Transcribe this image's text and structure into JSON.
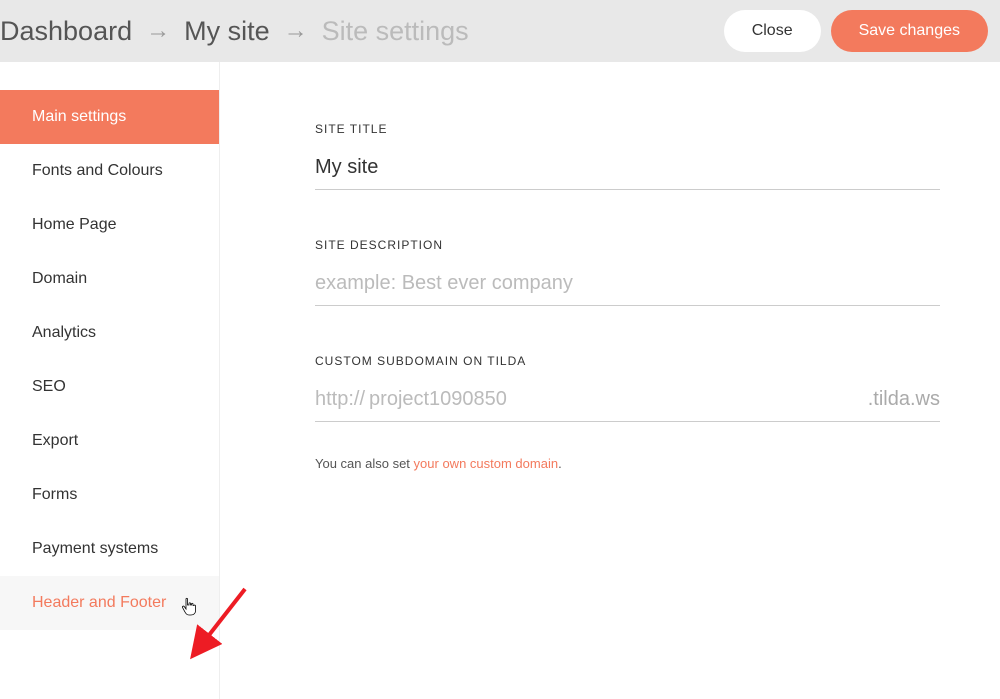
{
  "header": {
    "breadcrumb": {
      "dashboard": "Dashboard",
      "mysite": "My site",
      "settings": "Site settings"
    },
    "close_label": "Close",
    "save_label": "Save changes"
  },
  "sidebar": {
    "items": [
      {
        "label": "Main settings"
      },
      {
        "label": "Fonts and Colours"
      },
      {
        "label": "Home Page"
      },
      {
        "label": "Domain"
      },
      {
        "label": "Analytics"
      },
      {
        "label": "SEO"
      },
      {
        "label": "Export"
      },
      {
        "label": "Forms"
      },
      {
        "label": "Payment systems"
      },
      {
        "label": "Header and Footer"
      }
    ]
  },
  "main": {
    "site_title": {
      "label": "SITE TITLE",
      "value": "My site"
    },
    "site_description": {
      "label": "SITE DESCRIPTION",
      "placeholder": "example: Best ever company",
      "value": ""
    },
    "subdomain": {
      "label": "CUSTOM SUBDOMAIN ON TILDA",
      "prefix": "http://",
      "placeholder": "project1090850",
      "value": "",
      "suffix": ".tilda.ws"
    },
    "hint_text": "You can also set ",
    "hint_link": "your own custom domain",
    "hint_period": "."
  }
}
